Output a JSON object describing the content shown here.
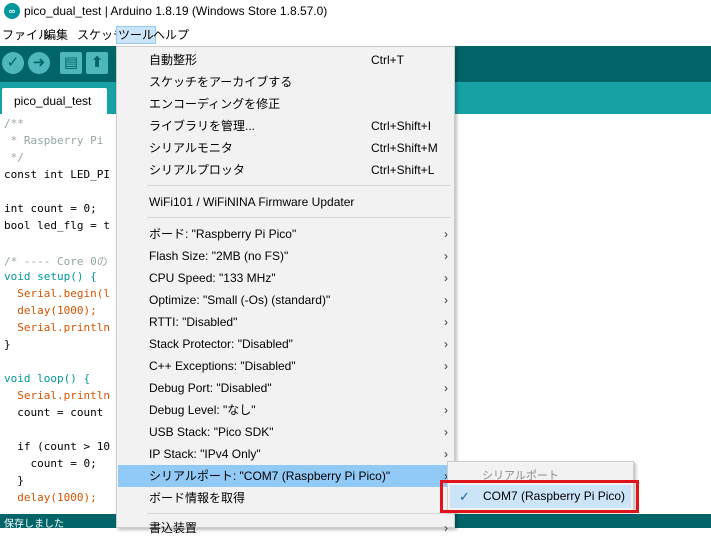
{
  "window": {
    "title": "pico_dual_test | Arduino 1.8.19 (Windows Store 1.8.57.0)"
  },
  "menubar": [
    "ファイル",
    "編集",
    "スケッチ",
    "ツール",
    "ヘルプ"
  ],
  "toolbar": {
    "verify_icon": "check-icon",
    "upload_icon": "right-arrow-icon",
    "new_icon": "file-icon",
    "open_icon": "up-arrow-icon"
  },
  "tab": {
    "name": "pico_dual_test"
  },
  "code": [
    "/**",
    " * Raspberry Pi",
    " */",
    "const int LED_PI",
    "",
    "int count = 0;",
    "bool led_flg = t",
    "",
    "/* ---- Core 0の",
    "void setup() {",
    "  Serial.begin(l",
    "  delay(1000);",
    "  Serial.println",
    "}",
    "",
    "void loop() {",
    "  Serial.println",
    "  count = count",
    "",
    "  if (count > 10",
    "    count = 0;",
    "  }",
    "  delay(1000);"
  ],
  "status": {
    "text": "保存しました"
  },
  "tools_menu": {
    "items": [
      {
        "label": "自動整形",
        "shortcut": "Ctrl+T"
      },
      {
        "label": "スケッチをアーカイブする",
        "shortcut": ""
      },
      {
        "label": "エンコーディングを修正",
        "shortcut": ""
      },
      {
        "label": "ライブラリを管理...",
        "shortcut": "Ctrl+Shift+I"
      },
      {
        "label": "シリアルモニタ",
        "shortcut": "Ctrl+Shift+M"
      },
      {
        "label": "シリアルプロッタ",
        "shortcut": "Ctrl+Shift+L"
      },
      {
        "label": "WiFi101 / WiFiNINA Firmware Updater",
        "shortcut": ""
      },
      {
        "label": "ボード: \"Raspberry Pi Pico\"",
        "shortcut": ""
      },
      {
        "label": "Flash Size: \"2MB (no FS)\"",
        "shortcut": ""
      },
      {
        "label": "CPU Speed: \"133 MHz\"",
        "shortcut": ""
      },
      {
        "label": "Optimize: \"Small (-Os) (standard)\"",
        "shortcut": ""
      },
      {
        "label": "RTTI: \"Disabled\"",
        "shortcut": ""
      },
      {
        "label": "Stack Protector: \"Disabled\"",
        "shortcut": ""
      },
      {
        "label": "C++ Exceptions: \"Disabled\"",
        "shortcut": ""
      },
      {
        "label": "Debug Port: \"Disabled\"",
        "shortcut": ""
      },
      {
        "label": "Debug Level: \"なし\"",
        "shortcut": ""
      },
      {
        "label": "USB Stack: \"Pico SDK\"",
        "shortcut": ""
      },
      {
        "label": "IP Stack: \"IPv4 Only\"",
        "shortcut": ""
      },
      {
        "label": "シリアルポート: \"COM7 (Raspberry Pi Pico)\"",
        "shortcut": ""
      },
      {
        "label": "ボード情報を取得",
        "shortcut": ""
      },
      {
        "label": "書込装置",
        "shortcut": ""
      }
    ],
    "submenu_arrow": "›"
  },
  "port_submenu": {
    "header": "シリアルポート",
    "selected": "COM7 (Raspberry Pi Pico)",
    "check": "✓"
  },
  "colors": {
    "toolbar": "#006468",
    "tabbar": "#17a1a5",
    "highlight": "#91c9f7",
    "annotation": "#e0121a"
  }
}
